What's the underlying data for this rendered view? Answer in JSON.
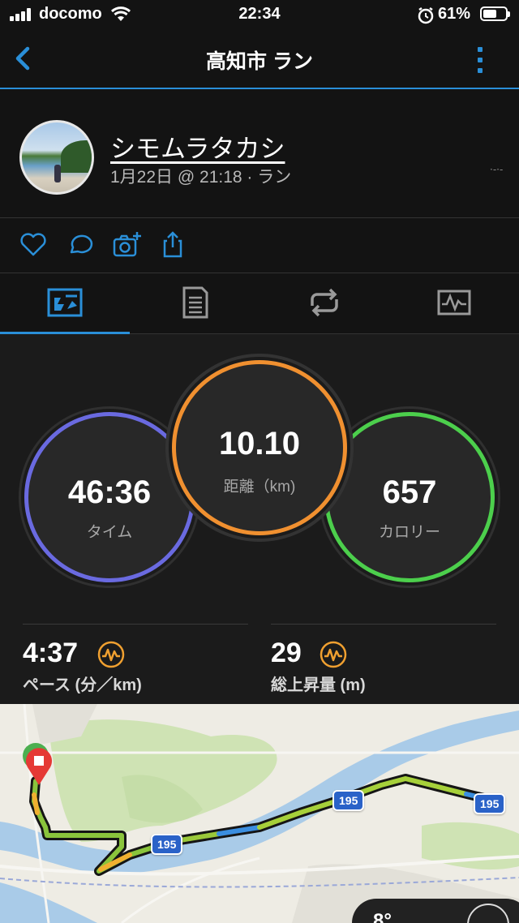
{
  "status_bar": {
    "carrier": "docomo",
    "time": "22:34",
    "battery_percent": "61%",
    "battery_level": 0.61
  },
  "nav": {
    "title": "高知市 ラン"
  },
  "profile": {
    "name": "シモムラタカシ",
    "subline": "1月22日 @ 21:18 · ラン",
    "mark": "·-·-"
  },
  "stats": {
    "time": {
      "value": "46:36",
      "label": "タイム"
    },
    "distance": {
      "value": "10.10",
      "label": "距離（km)"
    },
    "calories": {
      "value": "657",
      "label": "カロリー"
    },
    "pace": {
      "value": "4:37",
      "label": "ペース (分／km)"
    },
    "elevation": {
      "value": "29",
      "label": "総上昇量 (m)"
    }
  },
  "map": {
    "route_shields": [
      "195",
      "195",
      "195"
    ],
    "overlay_text": "8°"
  },
  "colors": {
    "accent": "#2a8fd8",
    "time_ring": "#6a6ae0",
    "distance_ring": "#f09030",
    "calorie_ring": "#4ccf4c",
    "metric_icon": "#f0a030"
  }
}
